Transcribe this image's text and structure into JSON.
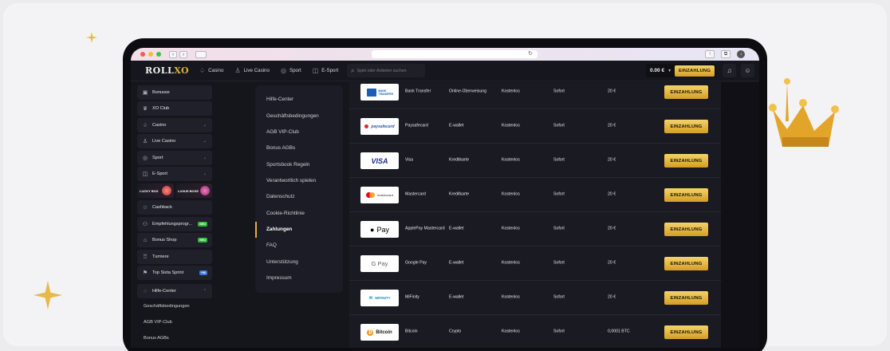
{
  "colors": {
    "gold": "#e0b13a",
    "bg": "#15151c",
    "panel": "#1c1c26",
    "green_tag": "#2db83a",
    "blue_tag": "#3a78d6"
  },
  "topnav": {
    "logo_a": "ROLL",
    "logo_b": "XO",
    "links": [
      {
        "label": "Casino",
        "icon": "casino-icon"
      },
      {
        "label": "Live Casino",
        "icon": "dealer-icon"
      },
      {
        "label": "Sport",
        "icon": "ball-icon"
      },
      {
        "label": "E-Sport",
        "icon": "gamepad-icon"
      }
    ],
    "search_placeholder": "Spiel oder Anbieter suchen",
    "balance": "0.00 €",
    "deposit_label": "EINZAHLUNG"
  },
  "sidebar": {
    "items": [
      {
        "label": "Bonusse"
      },
      {
        "label": "XO Club"
      },
      {
        "label": "Casino"
      },
      {
        "label": "Live Casino"
      },
      {
        "label": "Sport"
      },
      {
        "label": "E-Sport"
      },
      {
        "label": "Cashback"
      },
      {
        "label": "Empfehlungsprogr...",
        "tag": "NEU"
      },
      {
        "label": "Bonus Shop",
        "tag": "NEU"
      },
      {
        "label": "Turniere"
      },
      {
        "label": "Top Sixta Sprint",
        "tag": "+50"
      },
      {
        "label": "Hilfe-Center"
      }
    ],
    "promo": [
      {
        "label": "LUCKY BOX"
      },
      {
        "label": "LUXUS BOXE"
      }
    ],
    "subitems": [
      "Geschäftsbedingungen",
      "AGB VIP-Club",
      "Bonus AGBs"
    ]
  },
  "help_menu": {
    "items": [
      "Hilfe-Center",
      "Geschäftsbedingungen",
      "AGB VIP-Club",
      "Bonus AGBs",
      "Sportsbook Regeln",
      "Verantwortlich spielen",
      "Datenschutz",
      "Cookie-Richtlinie",
      "Zahlungen",
      "FAQ",
      "Unterstützung",
      "Impressum"
    ],
    "active": "Zahlungen"
  },
  "payments": {
    "button_label": "EINZAHLUNG",
    "rows": [
      {
        "logo": "BANK TRANSFER",
        "name": "Bank Transfer",
        "type": "Online-Überweisung",
        "fee": "Kostenlos",
        "speed": "Sofort",
        "min": "20 €"
      },
      {
        "logo": "paysafecard",
        "name": "Paysafecard",
        "type": "E-wallet",
        "fee": "Kostenlos",
        "speed": "Sofort",
        "min": "20 €"
      },
      {
        "logo": "VISA",
        "name": "Visa",
        "type": "Kreditkarte",
        "fee": "Kostenlos",
        "speed": "Sofort",
        "min": "20 €"
      },
      {
        "logo": "mastercard",
        "name": "Mastercard",
        "type": "Kreditkarte",
        "fee": "Kostenlos",
        "speed": "Sofort",
        "min": "20 €"
      },
      {
        "logo": "Pay",
        "name": "ApplePay Mastercard",
        "type": "E-wallet",
        "fee": "Kostenlos",
        "speed": "Sofort",
        "min": "20 €"
      },
      {
        "logo": "G Pay",
        "name": "Google Pay",
        "type": "E-wallet",
        "fee": "Kostenlos",
        "speed": "Sofort",
        "min": "20 €"
      },
      {
        "logo": "MIFINITY",
        "name": "MiFinity",
        "type": "E-wallet",
        "fee": "Kostenlos",
        "speed": "Sofort",
        "min": "20 €"
      },
      {
        "logo": "Bitcoin",
        "name": "Bitcoin",
        "type": "Crypto",
        "fee": "Kostenlos",
        "speed": "Sofort",
        "min": "0,0001 BTC"
      }
    ]
  }
}
